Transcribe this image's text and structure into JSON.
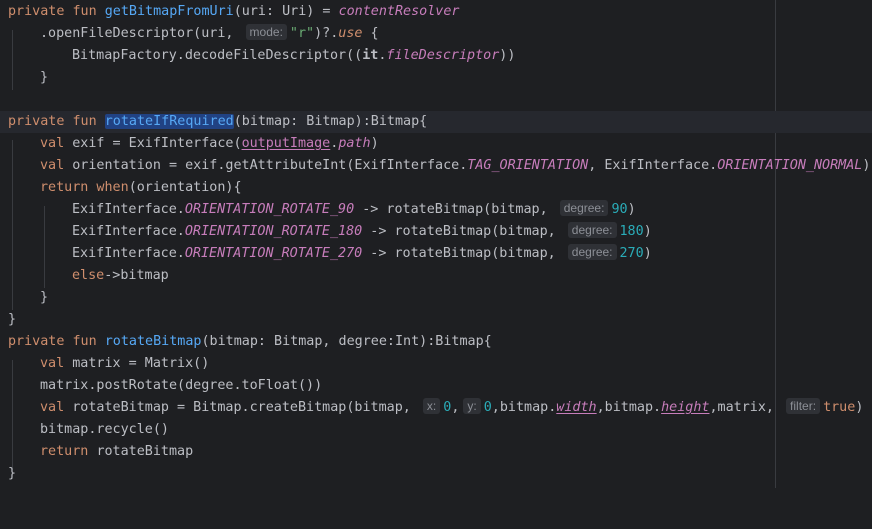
{
  "lines": {
    "l1": {
      "kw": "private fun ",
      "fn": "getBitmapFromUri",
      "rest": "(uri: Uri) = ",
      "prop": "contentResolver"
    },
    "l2": {
      "a": ".openFileDescriptor(uri, ",
      "hint": "mode:",
      "str": "\"r\"",
      "b": ")?.",
      "kw": "use",
      "c": " {"
    },
    "l3": {
      "a": "BitmapFactory.decodeFileDescriptor((",
      "kw": "it",
      "b": ".",
      "prop": "fileDescriptor",
      "c": "))"
    },
    "l4": {
      "a": "}"
    },
    "l6": {
      "kw": "private fun ",
      "fn": "rotateIfRequired",
      "rest": "(bitmap: Bitmap):Bitmap{"
    },
    "l7": {
      "kw": "val ",
      "a": "exif = ExifInterface(",
      "prop": "outputImage",
      "b": ".",
      "prop2": "path",
      "c": ")"
    },
    "l8": {
      "kw": "val ",
      "a": "orientation = exif.getAttributeInt(ExifInterface.",
      "prop": "TAG_ORIENTATION",
      "b": ", ExifInterface.",
      "prop2": "ORIENTATION_NORMAL",
      "c": ")"
    },
    "l9": {
      "kw": "return when",
      "a": "(orientation){"
    },
    "l10": {
      "a": "ExifInterface.",
      "prop": "ORIENTATION_ROTATE_90",
      "b": " -> rotateBitmap(bitmap, ",
      "hint": "degree:",
      "num": "90",
      "c": ")"
    },
    "l11": {
      "a": "ExifInterface.",
      "prop": "ORIENTATION_ROTATE_180",
      "b": " -> rotateBitmap(bitmap, ",
      "hint": "degree:",
      "num": "180",
      "c": ")"
    },
    "l12": {
      "a": "ExifInterface.",
      "prop": "ORIENTATION_ROTATE_270",
      "b": " -> rotateBitmap(bitmap, ",
      "hint": "degree:",
      "num": "270",
      "c": ")"
    },
    "l13": {
      "kw": "else",
      "a": "->bitmap"
    },
    "l14": {
      "a": "}"
    },
    "l15": {
      "a": "}"
    },
    "l16": {
      "kw": "private fun ",
      "fn": "rotateBitmap",
      "rest": "(bitmap: Bitmap, degree:Int):Bitmap{"
    },
    "l17": {
      "kw": "val ",
      "a": "matrix = Matrix()"
    },
    "l18": {
      "a": "matrix.postRotate(degree.toFloat())"
    },
    "l19": {
      "kw": "val ",
      "a": "rotateBitmap = Bitmap.createBitmap(bitmap, ",
      "hint1": "x:",
      "num1": "0",
      "b": ",",
      "hint2": "y:",
      "num2": "0",
      "c": ",bitmap.",
      "prop": "width",
      "d": ",bitmap.",
      "prop2": "height",
      "e": ",matrix, ",
      "hint3": "filter:",
      "kw2": "true",
      "f": ")"
    },
    "l20": {
      "a": "bitmap.recycle()"
    },
    "l21": {
      "kw": "return ",
      "a": "rotateBitmap"
    },
    "l22": {
      "a": "}"
    }
  },
  "colors": {
    "background": "#1e1f22",
    "keyword": "#cf8e6d",
    "function": "#56a8f5",
    "property": "#c77dbb",
    "string": "#6aab73",
    "number": "#2aacb8",
    "selection": "#214283"
  }
}
